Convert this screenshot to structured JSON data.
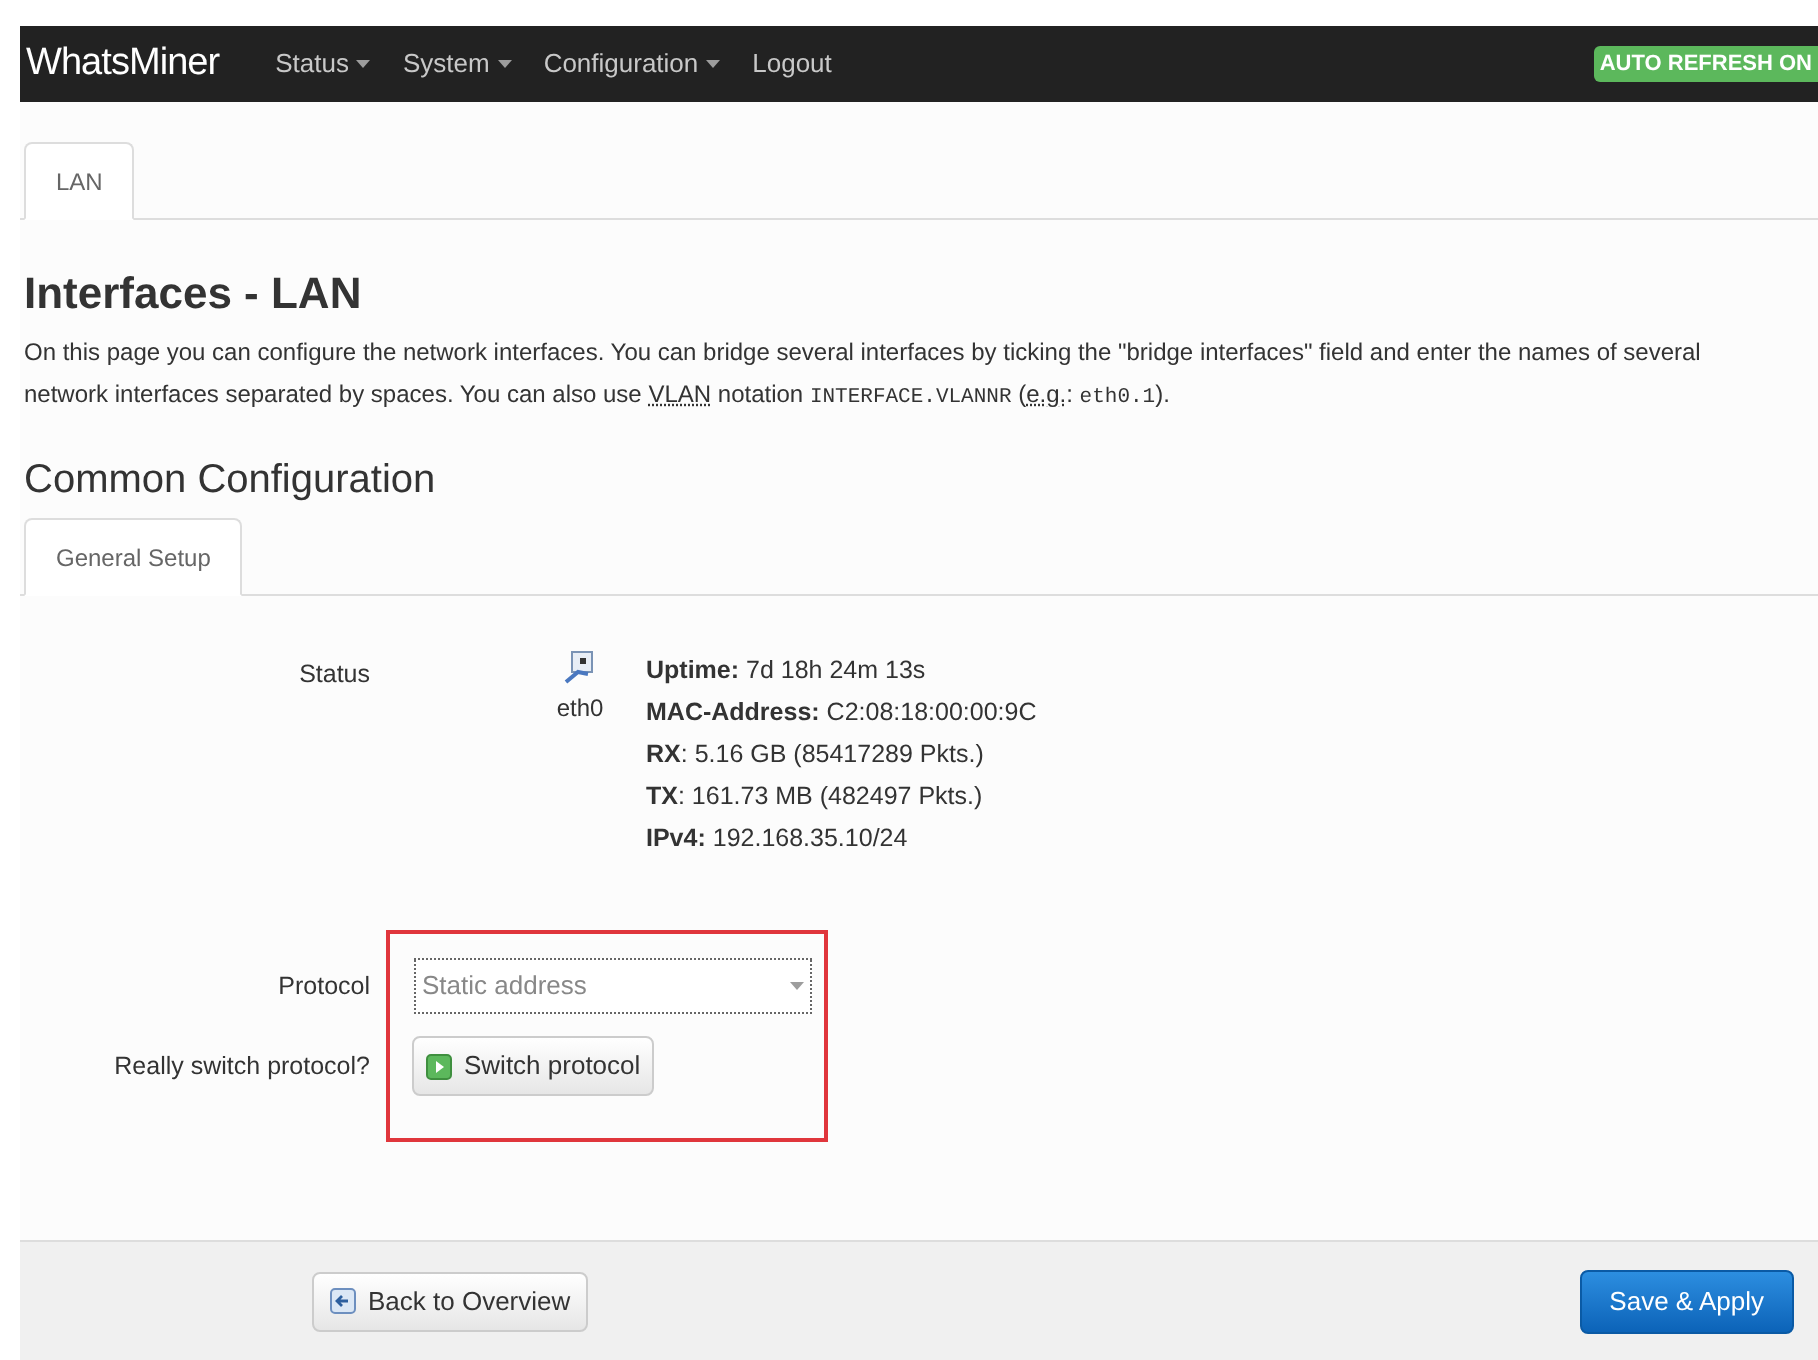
{
  "navbar": {
    "brand": "WhatsMiner",
    "menus": [
      {
        "label": "Status",
        "dropdown": true
      },
      {
        "label": "System",
        "dropdown": true
      },
      {
        "label": "Configuration",
        "dropdown": true
      },
      {
        "label": "Logout",
        "dropdown": false
      }
    ],
    "badge": "AUTO REFRESH ON"
  },
  "tabs": [
    {
      "label": "LAN",
      "selected": true
    }
  ],
  "heading": "Interfaces - LAN",
  "description": [
    {
      "kind": "text",
      "text": "On this page you can configure the network interfaces. You can bridge several interfaces by ticking the \"bridge interfaces\" field and enter the names of several network interfaces separated by spaces. You can also use "
    },
    {
      "kind": "abbr",
      "text": "VLAN"
    },
    {
      "kind": "text",
      "text": " notation "
    },
    {
      "kind": "code",
      "text": "INTERFACE.VLANNR"
    },
    {
      "kind": "text",
      "text": " ("
    },
    {
      "kind": "abbr",
      "text": "e.g."
    },
    {
      "kind": "text",
      "text": ": "
    },
    {
      "kind": "code",
      "text": "eth0.1"
    },
    {
      "kind": "text",
      "text": ")."
    }
  ],
  "section_title": "Common Configuration",
  "section_tabs": [
    {
      "label": "General Setup",
      "selected": true
    }
  ],
  "status": {
    "label": "Status",
    "device": "eth0",
    "lines": [
      {
        "key": "Uptime:",
        "value": "7d 18h 24m 13s"
      },
      {
        "key": "MAC-Address:",
        "value": "C2:08:18:00:00:9C"
      },
      {
        "key": "RX",
        "value": ": 5.16 GB (85417289 Pkts.)"
      },
      {
        "key": "TX",
        "value": ": 161.73 MB (482497 Pkts.)"
      },
      {
        "key": "IPv4:",
        "value": "192.168.35.10/24"
      }
    ]
  },
  "protocol": {
    "label": "Protocol",
    "value": "Static address"
  },
  "switch": {
    "label": "Really switch protocol?",
    "button": "Switch protocol"
  },
  "footer": {
    "back_button": "Back to Overview",
    "apply_button": "Save & Apply"
  }
}
